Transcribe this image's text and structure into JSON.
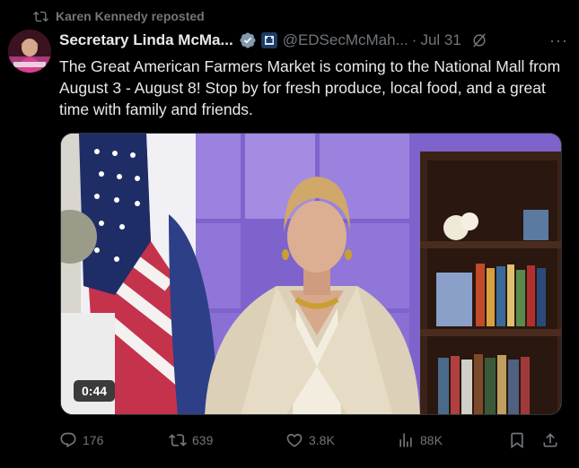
{
  "repost": {
    "text": "Karen Kennedy reposted",
    "icon": "repost-icon"
  },
  "author": {
    "display_name": "Secretary Linda McMa...",
    "handle": "@EDSecMcMah...",
    "separator": "·",
    "date": "Jul 31",
    "verified_icon": "verified-badge-icon",
    "affiliation_icon": "affiliation-badge-icon",
    "more_label": "···"
  },
  "tweet": {
    "text": "The Great American Farmers Market is coming to the National Mall from August 3 - August 8! Stop by for fresh produce, local food, and a great time with family and friends."
  },
  "media": {
    "duration": "0:44"
  },
  "actions": {
    "replies": "176",
    "reposts": "639",
    "likes": "3.8K",
    "views": "88K"
  },
  "colors": {
    "background": "#000000",
    "text": "#e7e9ea",
    "muted": "#71767b",
    "verified": "#829aab"
  }
}
